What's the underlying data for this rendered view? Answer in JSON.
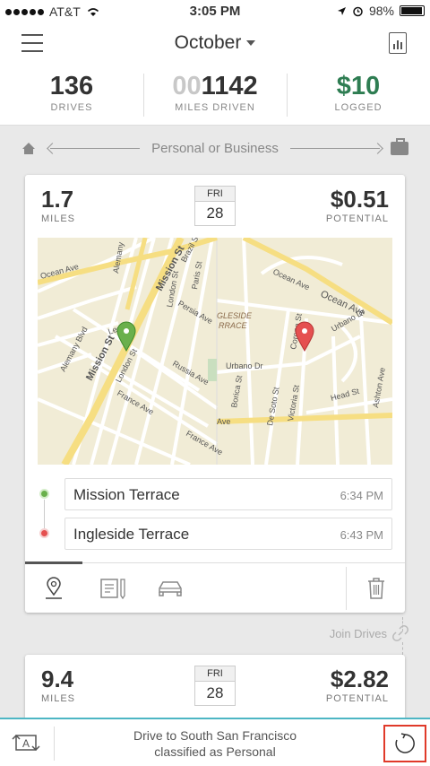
{
  "status_bar": {
    "carrier": "AT&T",
    "time": "3:05 PM",
    "battery": "98%"
  },
  "nav": {
    "month": "October"
  },
  "stats": {
    "drives_value": "136",
    "drives_label": "DRIVES",
    "miles_dim": "00",
    "miles_value": "1142",
    "miles_label": "MILES DRIVEN",
    "logged_value": "$10",
    "logged_label": "LOGGED"
  },
  "hint": {
    "text": "Personal or Business"
  },
  "drives": [
    {
      "miles": "1.7",
      "miles_label": "MILES",
      "dow": "FRI",
      "day": "28",
      "potential": "$0.51",
      "potential_label": "POTENTIAL",
      "start_name": "Mission Terrace",
      "start_time": "6:34 PM",
      "end_name": "Ingleside Terrace",
      "end_time": "6:43 PM"
    },
    {
      "miles": "9.4",
      "miles_label": "MILES",
      "dow": "FRI",
      "day": "28",
      "potential": "$2.82",
      "potential_label": "POTENTIAL"
    }
  ],
  "map_labels": {
    "ocean_ave": "Ocean Ave",
    "ocean_ave_2": "Ocean Ave",
    "ocean_ave_3": "Ocean Ave",
    "mission_st": "Mission St",
    "mission_st_2": "Mission St",
    "alemany": "Alemany Blvd",
    "alemany_2": "Alemany",
    "london_st": "London St",
    "london_st_2": "London St",
    "paris_st": "Paris St",
    "persia_ave": "Persia Ave",
    "russia_ave": "Russia Ave",
    "france_ave": "France Ave",
    "france_ave_2": "France Ave",
    "leo_st": "Leo St",
    "brazil_st": "Brazil St",
    "ingleside": "GLESIDE",
    "ingleside_2": "RRACE",
    "urbano_dr": "Urbano Dr",
    "urbano_dr_2": "Urbano Dr",
    "corona_st": "Corona St",
    "borica_st": "Borica St",
    "desoto_st": "De Soto St",
    "victoria_st": "Victoria St",
    "head_st": "Head St",
    "ashton_ave": "Ashton Ave",
    "ave": "Ave"
  },
  "join_drives": "Join Drives",
  "toast": {
    "line1": "Drive to South San Francisco",
    "line2": "classified as Personal"
  },
  "colors": {
    "accent_green": "#2e7d52",
    "toast_border": "#4db6c4",
    "highlight_red": "#e03a2a"
  }
}
